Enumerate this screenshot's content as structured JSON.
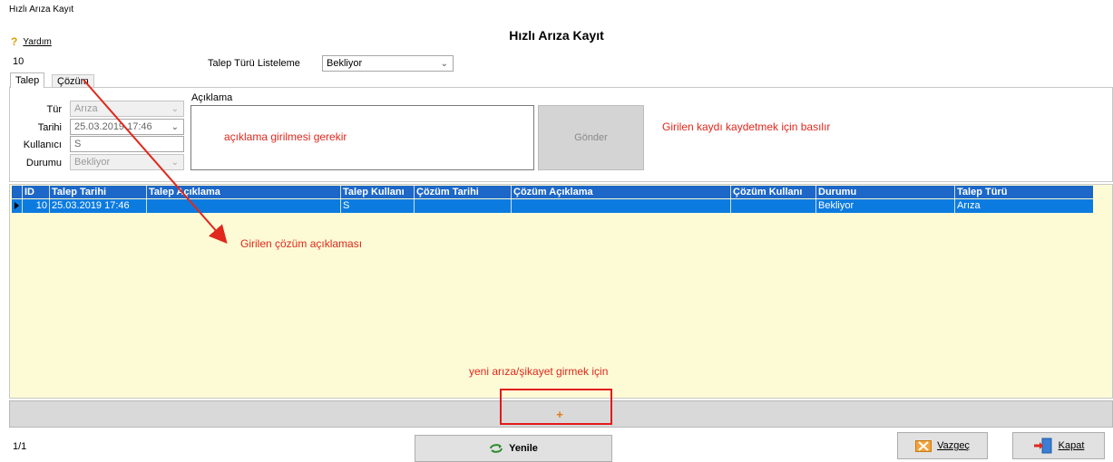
{
  "window": {
    "title": "Hızlı Arıza Kayıt"
  },
  "page": {
    "title": "Hızlı Arıza Kayıt"
  },
  "help": {
    "icon": "question-icon",
    "label": "Yardım"
  },
  "record": {
    "number": "10"
  },
  "filter": {
    "label": "Talep Türü Listeleme",
    "selected": "Bekliyor"
  },
  "tabs": [
    {
      "label": "Talep"
    },
    {
      "label": "Çözüm"
    }
  ],
  "form": {
    "tur": {
      "label": "Tür",
      "value": "Arıza"
    },
    "tarih": {
      "label": "Tarihi",
      "value": "25.03.2019 17:46"
    },
    "kullanici": {
      "label": "Kullanıcı",
      "value": "S"
    },
    "durum": {
      "label": "Durumu",
      "value": "Bekliyor"
    },
    "aciklama": {
      "label": "Açıklama"
    },
    "gonder_label": "Gönder"
  },
  "annotations": {
    "aciklama_note": "açıklama girilmesi gerekir",
    "gonder_note": "Girilen kaydı kaydetmek için basılır",
    "cozum_note": "Girilen çözüm açıklaması",
    "add_note": "yeni arıza/şikayet girmek için"
  },
  "grid": {
    "columns": [
      "ID",
      "Talep Tarihi",
      "Talep Açıklama",
      "Talep Kullanı",
      "Çözüm Tarihi",
      "Çözüm Açıklama",
      "Çözüm Kullanı",
      "Durumu",
      "Talep Türü"
    ],
    "rows": [
      [
        "10",
        "25.03.2019 17:46",
        "",
        "S",
        "",
        "",
        "",
        "Bekliyor",
        "Arıza"
      ]
    ]
  },
  "add_button": {
    "label": "+"
  },
  "pager": {
    "text": "1/1"
  },
  "buttons": {
    "yenile": "Yenile",
    "vazgec": "Vazgeç",
    "kapat": "Kapat"
  },
  "colors": {
    "accent": "#0c7be0",
    "annotation": "#e0281c",
    "grid_bg": "#fdfbd6"
  }
}
